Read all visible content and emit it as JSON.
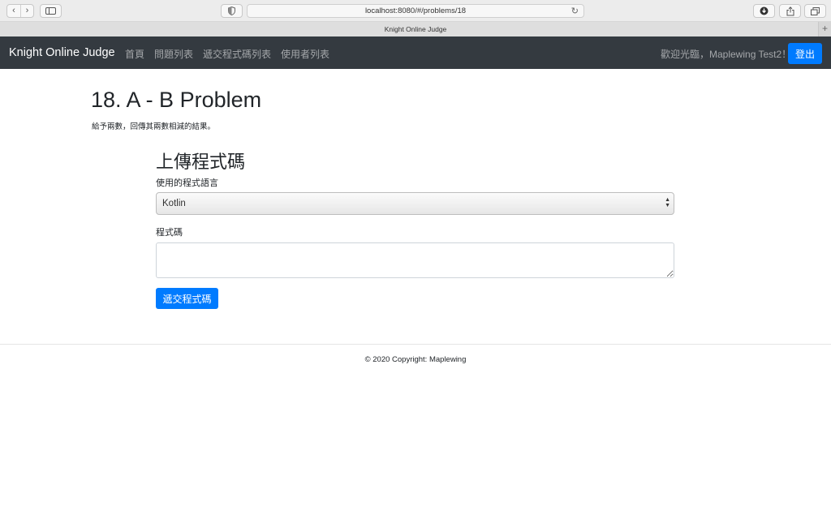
{
  "browser": {
    "url": "localhost:8080/#/problems/18",
    "tab_title": "Knight Online Judge",
    "icons": [
      "chevron-left-icon",
      "chevron-right-icon",
      "sidebar-icon",
      "shield-icon",
      "reload-icon",
      "download-icon",
      "share-icon",
      "tabs-icon",
      "plus-icon"
    ]
  },
  "navbar": {
    "brand": "Knight Online Judge",
    "links": [
      "首頁",
      "問題列表",
      "遞交程式碼列表",
      "使用者列表"
    ],
    "welcome": "歡迎光臨，Maplewing Test2！",
    "logout_label": "登出"
  },
  "problem": {
    "title": "18. A - B Problem",
    "description": "給予兩數，回傳其兩數相減的結果。"
  },
  "upload": {
    "heading": "上傳程式碼",
    "language_label": "使用的程式語言",
    "language_selected": "Kotlin",
    "code_label": "程式碼",
    "code_value": "",
    "submit_label": "遞交程式碼"
  },
  "footer": {
    "copyright": "© 2020 Copyright: Maplewing"
  },
  "colors": {
    "navbar_bg": "#343a40",
    "primary": "#007bff"
  }
}
